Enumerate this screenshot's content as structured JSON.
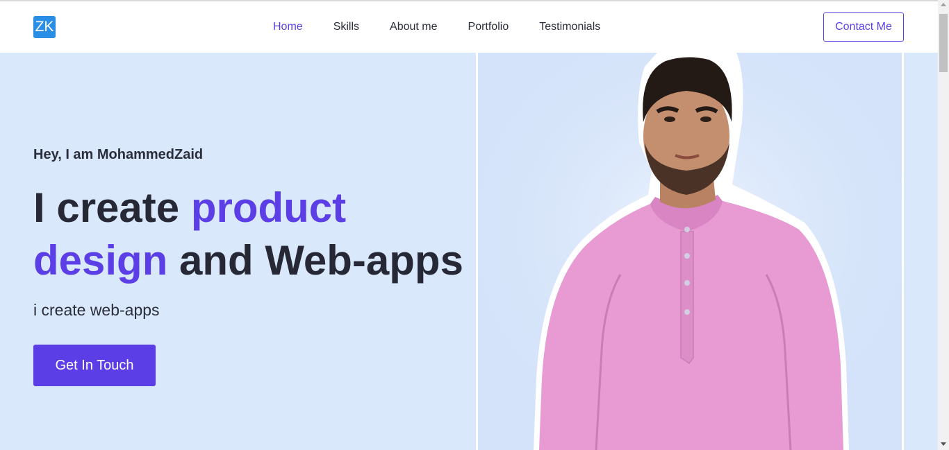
{
  "nav": {
    "logo": "ZK",
    "links": [
      "Home",
      "Skills",
      "About me",
      "Portfolio",
      "Testimonials"
    ],
    "active": "Home",
    "contact_label": "Contact Me"
  },
  "hero": {
    "greeting": "Hey, I am MohammedZaid",
    "headline_part1": "I create ",
    "headline_accent": "product design",
    "headline_part2": " and Web-apps",
    "subline": "i create web-apps",
    "cta_label": "Get In Touch",
    "photo_icon": "portrait-photo"
  },
  "colors": {
    "accent": "#5b3ee6",
    "hero_background": "#dae8fb",
    "text_dark": "#262836",
    "logo_background": "#2a8ee6"
  }
}
